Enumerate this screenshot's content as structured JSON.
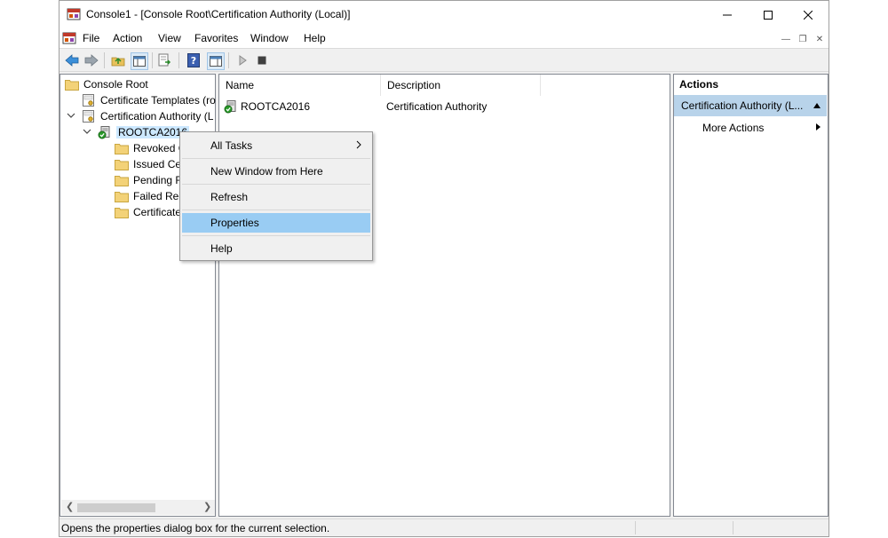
{
  "window": {
    "title": "Console1 - [Console Root\\Certification Authority (Local)]",
    "controls": [
      "minimize",
      "maximize",
      "close"
    ]
  },
  "menu": {
    "items": [
      "File",
      "Action",
      "View",
      "Favorites",
      "Window",
      "Help"
    ]
  },
  "toolbar": {
    "buttons": [
      "back",
      "forward",
      "up-one-level",
      "show-hide-console-tree",
      "export-list",
      "help",
      "show-hide-action-pane",
      "start-service",
      "stop-service"
    ]
  },
  "tree": {
    "root": "Console Root",
    "nodes": [
      {
        "label": "Certificate Templates (ro"
      },
      {
        "label": "Certification Authority (L"
      },
      {
        "label": "ROOTCA2016"
      },
      {
        "label": "Revoked C"
      },
      {
        "label": "Issued Cer"
      },
      {
        "label": "Pending R"
      },
      {
        "label": "Failed Rec"
      },
      {
        "label": "Certificate"
      }
    ]
  },
  "list": {
    "columns": [
      "Name",
      "Description"
    ],
    "rows": [
      {
        "name": "ROOTCA2016",
        "description": "Certification Authority"
      }
    ]
  },
  "actions": {
    "title": "Actions",
    "group": "Certification Authority (L...",
    "items": [
      "More Actions"
    ]
  },
  "context_menu": {
    "items": [
      "All Tasks",
      "New Window from Here",
      "Refresh",
      "Properties",
      "Help"
    ],
    "highlighted": "Properties"
  },
  "status": {
    "text": "Opens the properties dialog box for the current selection."
  },
  "colors": {
    "selection": "#cce8ff",
    "menu_highlight": "#99ccf3",
    "action_group": "#b8d3ea",
    "ca_icon_green": "#2a9a2a"
  }
}
